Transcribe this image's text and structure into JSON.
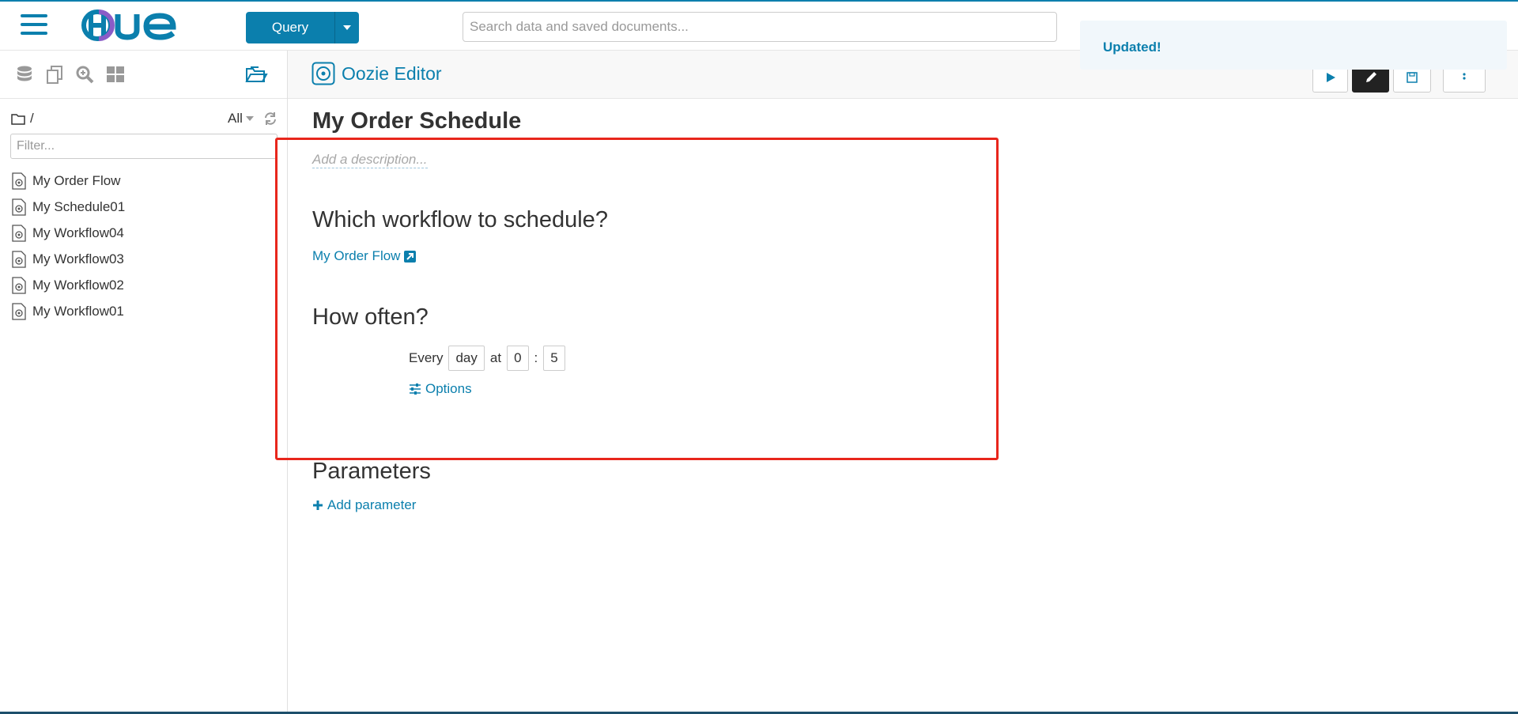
{
  "topbar": {
    "logo_text": "HUE",
    "query_button": "Query",
    "search_placeholder": "Search data and saved documents..."
  },
  "sidebar": {
    "path": "/",
    "filter_option": "All",
    "filter_placeholder": "Filter...",
    "documents": [
      {
        "name": "My Order Flow"
      },
      {
        "name": "My Schedule01"
      },
      {
        "name": "My Workflow04"
      },
      {
        "name": "My Workflow03"
      },
      {
        "name": "My Workflow02"
      },
      {
        "name": "My Workflow01"
      }
    ]
  },
  "header": {
    "editor_title": "Oozie Editor",
    "toast": "Updated!"
  },
  "schedule": {
    "name": "My Order Schedule",
    "description_placeholder": "Add a description...",
    "workflow_heading": "Which workflow to schedule?",
    "workflow_link": "My Order Flow",
    "frequency_heading": "How often?",
    "every_label": "Every",
    "unit": "day",
    "at_label": "at",
    "hour": "0",
    "separator": ":",
    "minute": "5",
    "options_label": "Options",
    "parameters_heading": "Parameters",
    "add_parameter_label": "Add parameter"
  },
  "colors": {
    "accent": "#0b7fad",
    "highlight_box": "#e8261c"
  }
}
